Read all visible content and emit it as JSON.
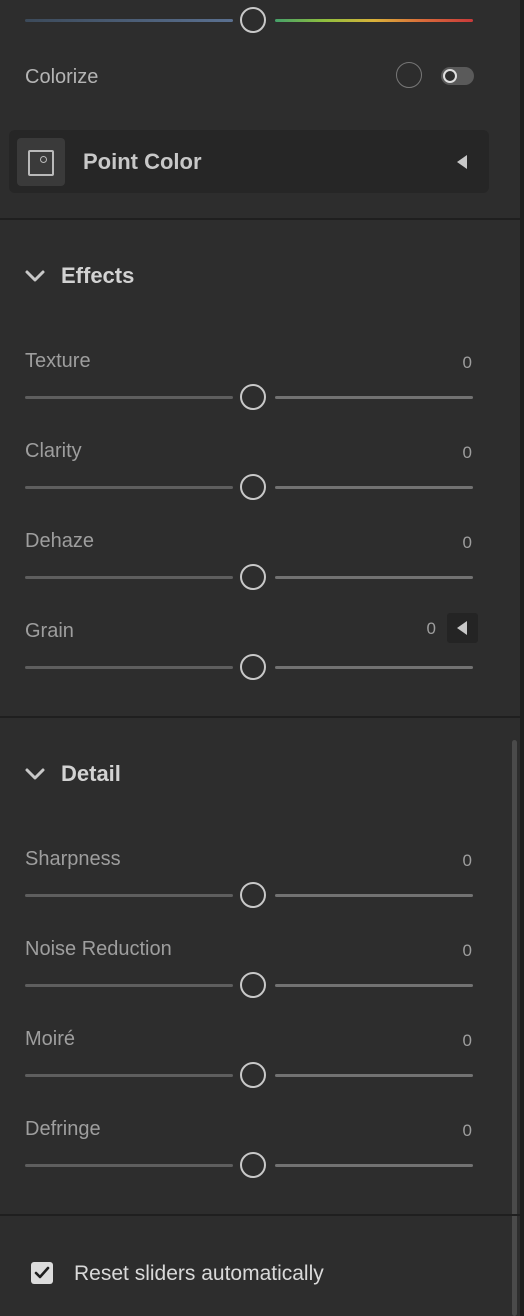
{
  "hsl": {
    "colorize_label": "Colorize",
    "point_color_title": "Point Color"
  },
  "effects": {
    "title": "Effects",
    "sliders": [
      {
        "label": "Texture",
        "value": "0"
      },
      {
        "label": "Clarity",
        "value": "0"
      },
      {
        "label": "Dehaze",
        "value": "0"
      },
      {
        "label": "Grain",
        "value": "0"
      }
    ]
  },
  "detail": {
    "title": "Detail",
    "sliders": [
      {
        "label": "Sharpness",
        "value": "0"
      },
      {
        "label": "Noise Reduction",
        "value": "0"
      },
      {
        "label": "Moiré",
        "value": "0"
      },
      {
        "label": "Defringe",
        "value": "0"
      }
    ]
  },
  "footer": {
    "reset_label": "Reset sliders automatically",
    "reset_checked": true
  },
  "colors": {
    "panel_bg": "#2d2d2d",
    "divider": "#1f1f1f",
    "thumb": "#c8c8c8"
  }
}
